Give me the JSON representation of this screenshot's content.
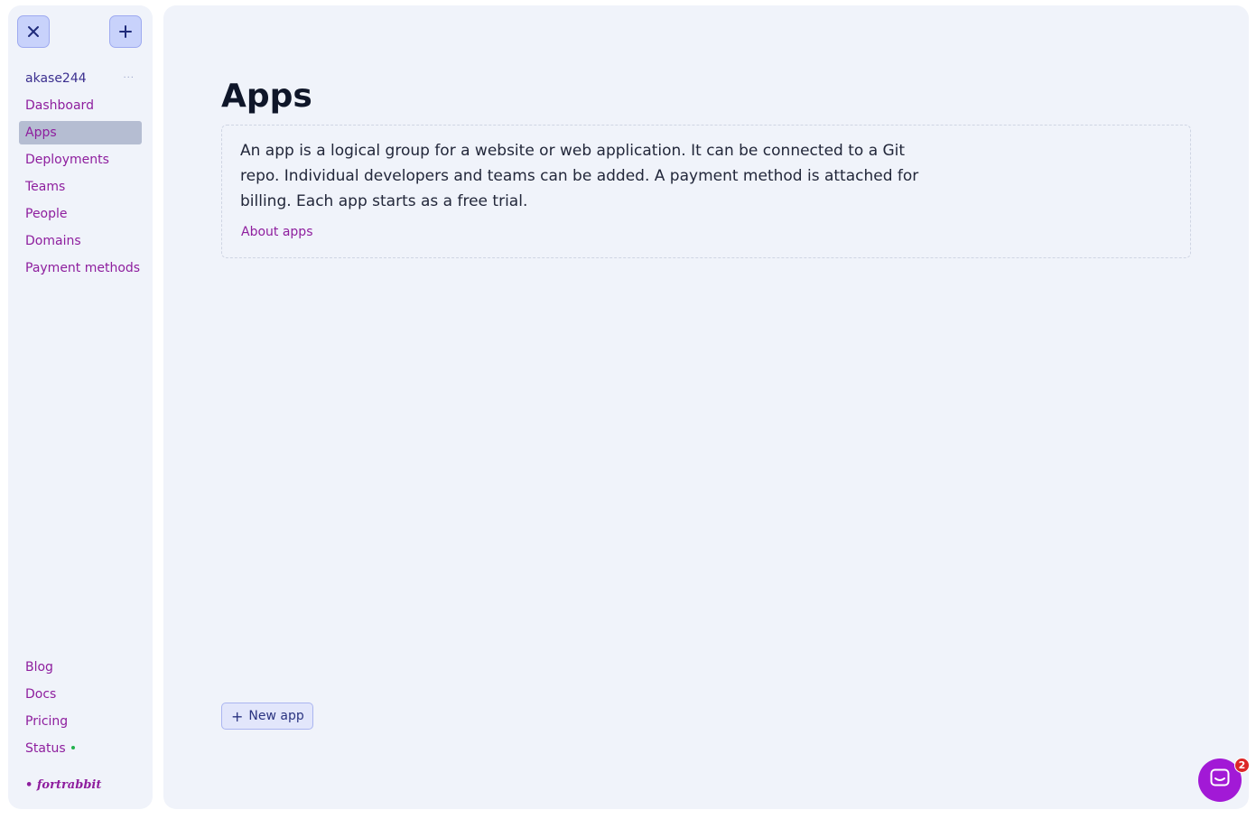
{
  "sidebar": {
    "user": "akase244",
    "user_menu": "···",
    "items": [
      {
        "label": "Dashboard"
      },
      {
        "label": "Apps"
      },
      {
        "label": "Deployments"
      },
      {
        "label": "Teams"
      },
      {
        "label": "People"
      },
      {
        "label": "Domains"
      },
      {
        "label": "Payment methods"
      }
    ],
    "active_item": "Apps",
    "footer": [
      {
        "label": "Blog"
      },
      {
        "label": "Docs"
      },
      {
        "label": "Pricing"
      },
      {
        "label": "Status"
      }
    ],
    "brand": "• fortrabbit"
  },
  "main": {
    "title": "Apps",
    "description": "An app is a logical group for a website or web application. It can be connected to a Git repo. Individual developers and teams can be added. A payment method is attached for billing. Each app starts as a free trial.",
    "about_link": "About apps",
    "new_app_label": "New app",
    "new_app_icon": "+"
  },
  "chat": {
    "badge_count": "2"
  },
  "colors": {
    "accent": "#8e1e9e",
    "panel_bg": "#f0f3fa",
    "button_bg": "#c8d2fb",
    "chat_bg": "#a219d6",
    "badge": "#dc2626",
    "status": "#22b14c"
  },
  "icons": {
    "close": "close-icon",
    "add": "plus-icon",
    "chat": "chat-icon"
  }
}
